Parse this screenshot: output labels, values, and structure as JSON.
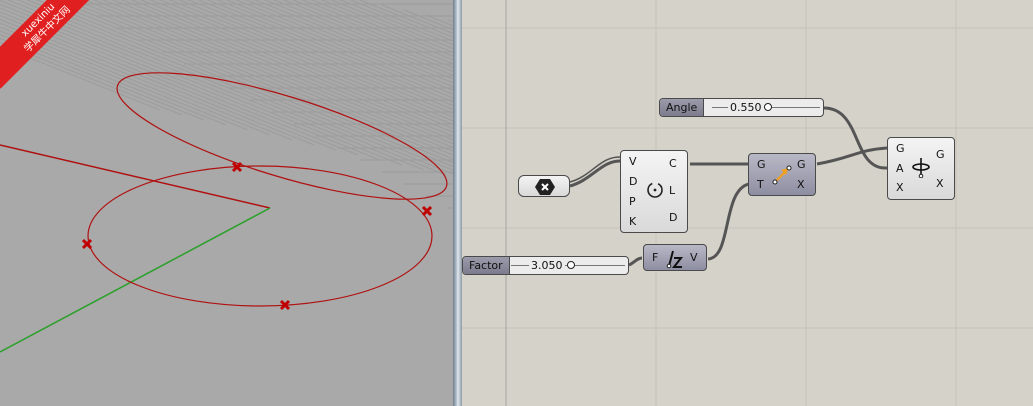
{
  "watermark": {
    "line1": "xuexiniu",
    "line2": "学犀牛中文网"
  },
  "sliders": {
    "angle": {
      "name": "Angle",
      "value": "0.550"
    },
    "factor": {
      "name": "Factor",
      "value": "3.050"
    }
  },
  "components": {
    "circle": {
      "inputs": [
        "V",
        "D",
        "P",
        "K"
      ],
      "outputs": [
        "C",
        "L",
        "D"
      ]
    },
    "move": {
      "inputs": [
        "G",
        "T"
      ],
      "outputs": [
        "G",
        "X"
      ]
    },
    "amplitude": {
      "inputs": [
        "F"
      ],
      "outputs": [
        "V"
      ]
    },
    "rotate": {
      "inputs": [
        "G",
        "A",
        "X"
      ],
      "outputs": [
        "G",
        "X"
      ]
    }
  },
  "colors": {
    "curve": "#b01010",
    "x_axis": "#b01010",
    "y_axis": "#2aa02a",
    "canvas_bg": "#d5d2ca"
  }
}
